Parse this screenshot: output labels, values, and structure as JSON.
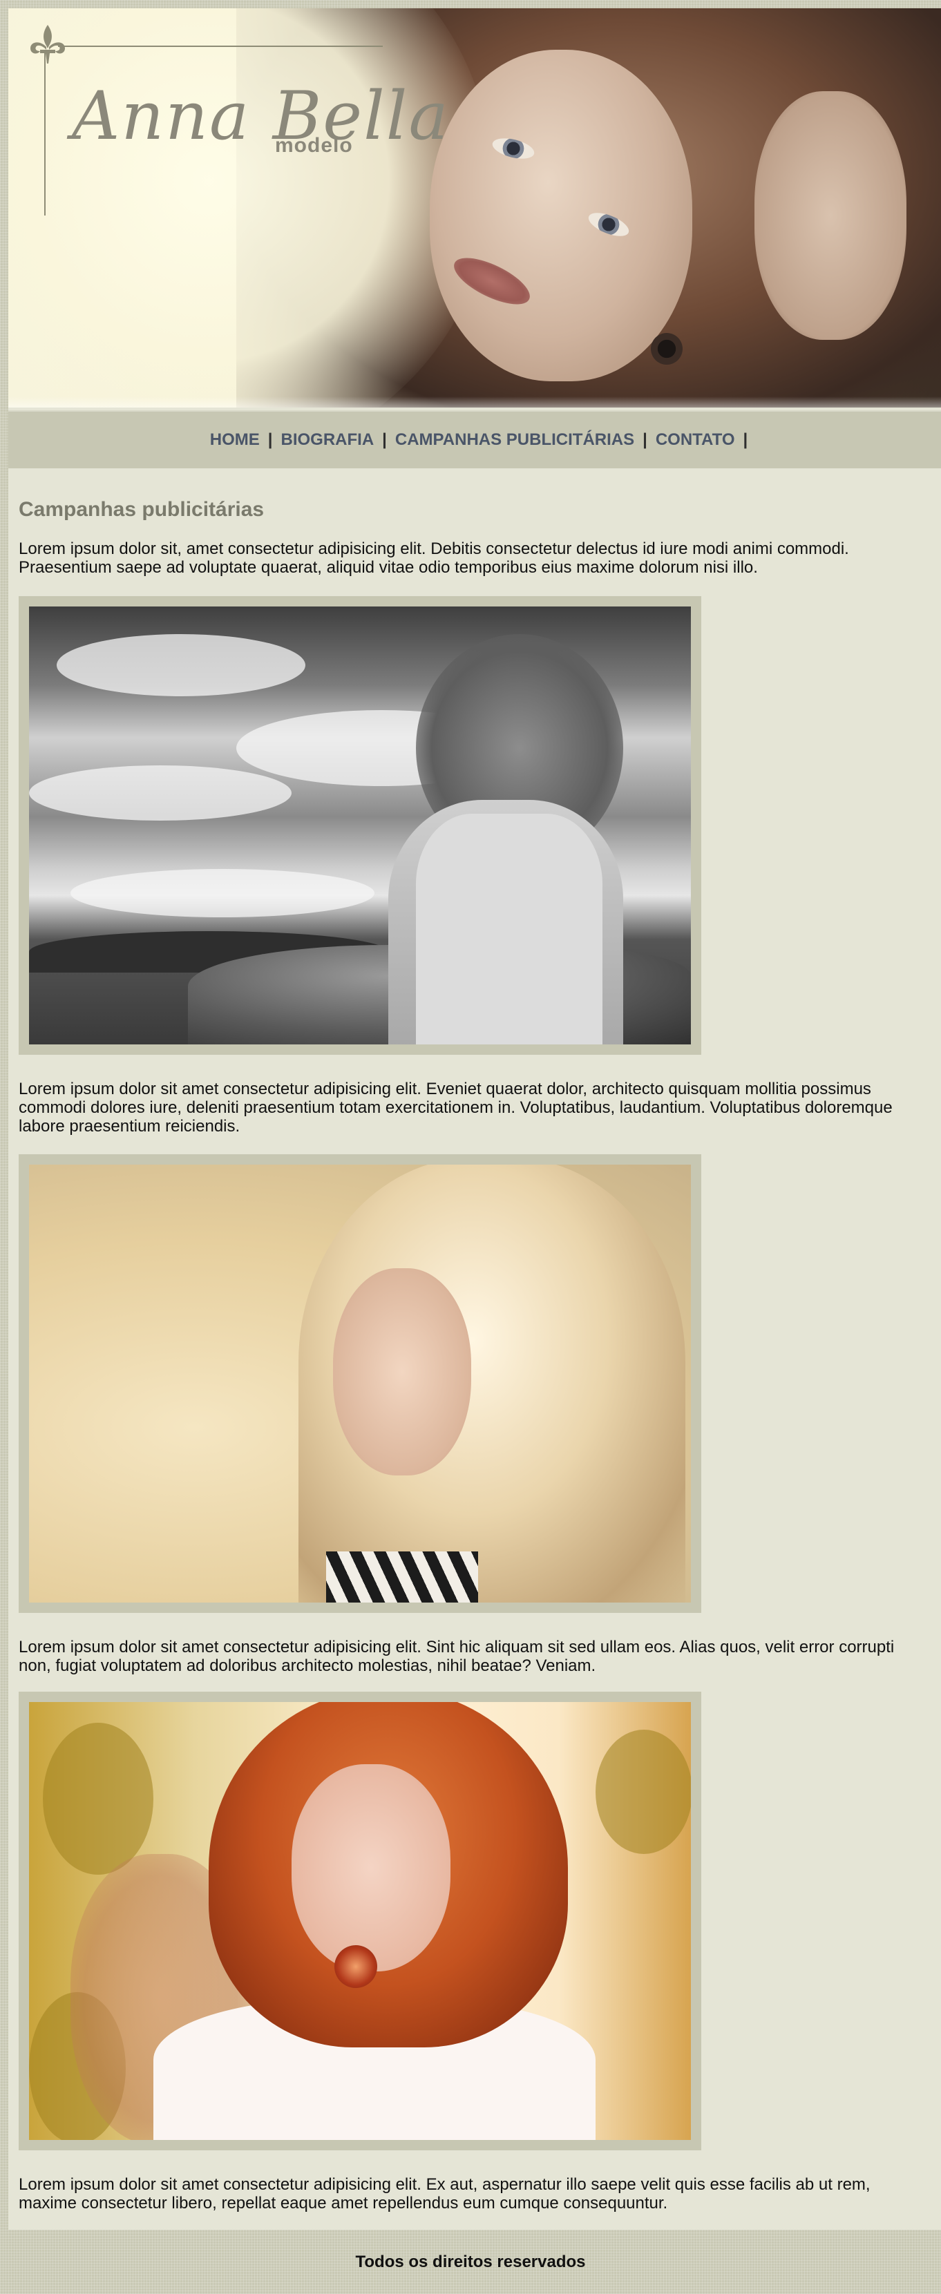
{
  "header": {
    "brand_name": "Anna Bella",
    "brand_subtitle": "modelo"
  },
  "nav": {
    "items": [
      {
        "label": "HOME"
      },
      {
        "label": "BIOGRAFIA"
      },
      {
        "label": "CAMPANHAS PUBLICITÁRIAS"
      },
      {
        "label": "CONTATO"
      }
    ],
    "separator": "|",
    "link_color": "#4a5568"
  },
  "main": {
    "title": "Campanhas publicitárias",
    "paragraphs": [
      "Lorem ipsum dolor sit, amet consectetur adipisicing elit. Debitis consectetur delectus id iure modi animi commodi. Praesentium saepe ad voluptate quaerat, aliquid vitae odio temporibus eius maxime dolorum nisi illo.",
      "Lorem ipsum dolor sit amet consectetur adipisicing elit. Eveniet quaerat dolor, architecto quisquam mollitia possimus commodi dolores iure, deleniti praesentium totam exercitationem in. Voluptatibus, laudantium. Voluptatibus doloremque labore praesentium reiciendis.",
      "Lorem ipsum dolor sit amet consectetur adipisicing elit. Sint hic aliquam sit sed ullam eos. Alias quos, velit error corrupti non, fugiat voluptatem ad doloribus architecto molestias, nihil beatae? Veniam.",
      "Lorem ipsum dolor sit amet consectetur adipisicing elit. Ex aut, aspernatur illo saepe velit quis esse facilis ab ut rem, maxime consectetur libero, repellat eaque amet repellendus eum cumque consequuntur."
    ],
    "photos": [
      {
        "subject": "black-and-white photo of a woman with wind-blown hair looking at the sea"
      },
      {
        "subject": "sunlit photo of a blonde woman with long hair"
      },
      {
        "subject": "bright photo of a red-haired woman wearing a round earring"
      }
    ]
  },
  "footer": {
    "text": "Todos os direitos reservados"
  },
  "colors": {
    "page_background": "#c9c9b4",
    "content_background": "#e5e5d6",
    "nav_background": "#c7c7b3",
    "frame_background": "#c7c7b2",
    "title_color": "#7a7a6c"
  }
}
